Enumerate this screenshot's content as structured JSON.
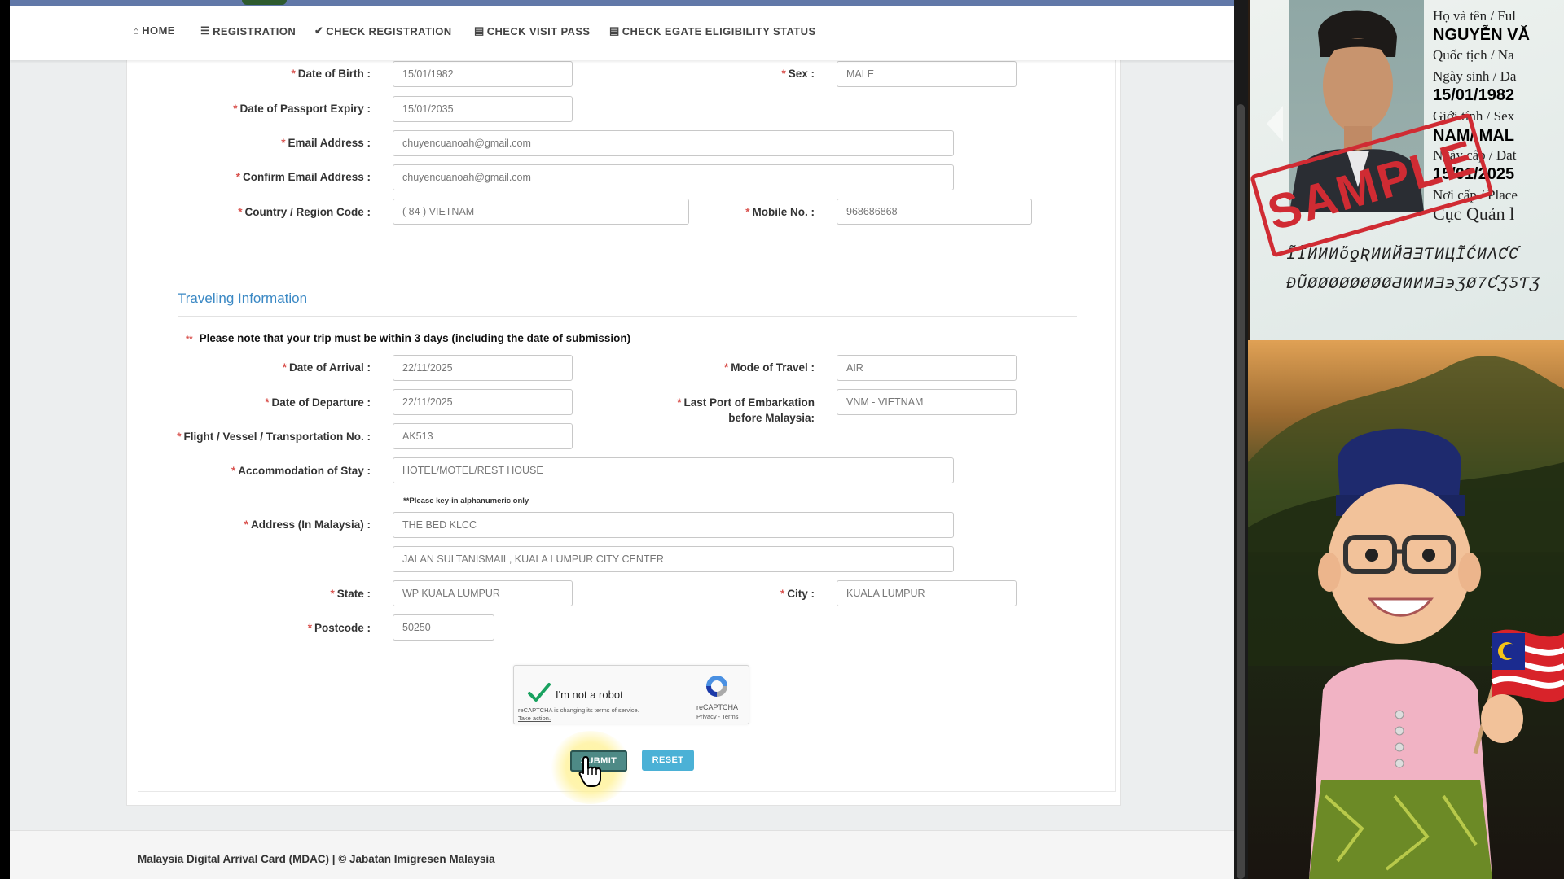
{
  "nav": {
    "items": [
      {
        "label": "HOME",
        "icon": "home-icon"
      },
      {
        "label": "REGISTRATION",
        "icon": "list-icon"
      },
      {
        "label": "CHECK REGISTRATION",
        "icon": "check-circle-icon"
      },
      {
        "label": "CHECK VISIT PASS",
        "icon": "document-icon"
      },
      {
        "label": "CHECK EGATE ELIGIBILITY STATUS",
        "icon": "document-icon"
      }
    ]
  },
  "personal": {
    "dob_label": "Date of Birth :",
    "dob": "15/01/1982",
    "sex_label": "Sex :",
    "sex": "MALE",
    "passport_expiry_label": "Date of Passport Expiry :",
    "passport_expiry": "15/01/2035",
    "email_label": "Email Address :",
    "email": "chuyencuanoah@gmail.com",
    "confirm_email_label": "Confirm Email Address :",
    "confirm_email": "chuyencuanoah@gmail.com",
    "country_code_label": "Country / Region Code :",
    "country_code": "( 84 ) VIETNAM",
    "mobile_label": "Mobile No. :",
    "mobile": "968686868"
  },
  "travel": {
    "section_title": "Traveling Information",
    "note_star": "**",
    "note": "Please note that your trip must be within 3 days (including the date of submission)",
    "arrival_label": "Date of Arrival :",
    "arrival": "22/11/2025",
    "mode_label": "Mode of Travel :",
    "mode": "AIR",
    "departure_label": "Date of Departure :",
    "departure": "22/11/2025",
    "port_label_1": "Last Port of Embarkation",
    "port_label_2": "before Malaysia:",
    "port": "VNM - VIETNAM",
    "flight_label": "Flight / Vessel / Transportation No. :",
    "flight": "AK513",
    "accommodation_label": "Accommodation of Stay :",
    "accommodation": "HOTEL/MOTEL/REST HOUSE",
    "alnum_hint": "**Please key-in alphanumeric only",
    "address_label": "Address (In Malaysia) :",
    "address1": "THE BED KLCC",
    "address2": "JALAN SULTANISMAIL, KUALA LUMPUR CITY CENTER",
    "state_label": "State :",
    "state": "WP KUALA LUMPUR",
    "city_label": "City :",
    "city": "KUALA LUMPUR",
    "postcode_label": "Postcode :",
    "postcode": "50250"
  },
  "recaptcha": {
    "label": "I'm not a robot",
    "notice": "reCAPTCHA is changing its terms of service.",
    "notice_link": "Take action.",
    "brand": "reCAPTCHA",
    "terms": "Privacy - Terms"
  },
  "buttons": {
    "submit": "SUBMIT",
    "reset": "RESET"
  },
  "footer": {
    "text": "Malaysia Digital Arrival Card (MDAC) | © Jabatan Imigresen Malaysia"
  },
  "passport_sample": {
    "name_label": "Họ và tên / Ful",
    "name": "NGUYỄN VĂ",
    "nationality_label": "Quốc tịch / Na",
    "dob_label": "Ngày sinh / Da",
    "dob": "15/01/1982",
    "sex_label": "Giới tính / Sex",
    "sex": "NAM/ MAL",
    "issue_label": "Ngày cấp / Dat",
    "issue": "15/01/2025",
    "place_label": "Nơi cấp / Place",
    "place": "Cục Quản l",
    "mrz1": "ĨĨИИИὄƍƦИИЙƋƎƬИЦĨĆИΛƇƇ",
    "mrz2": "ĐŨØØØØØØØØƋИИИƎ϶ƷØ7ƇƷƼƬƷ",
    "stamp": "SAMPLE"
  },
  "colors": {
    "accent_blue": "#3a88c4",
    "required_red": "#d9534f",
    "submit": "#4e8a86",
    "reset": "#4bb1d6",
    "topbar": "#6178a8"
  }
}
